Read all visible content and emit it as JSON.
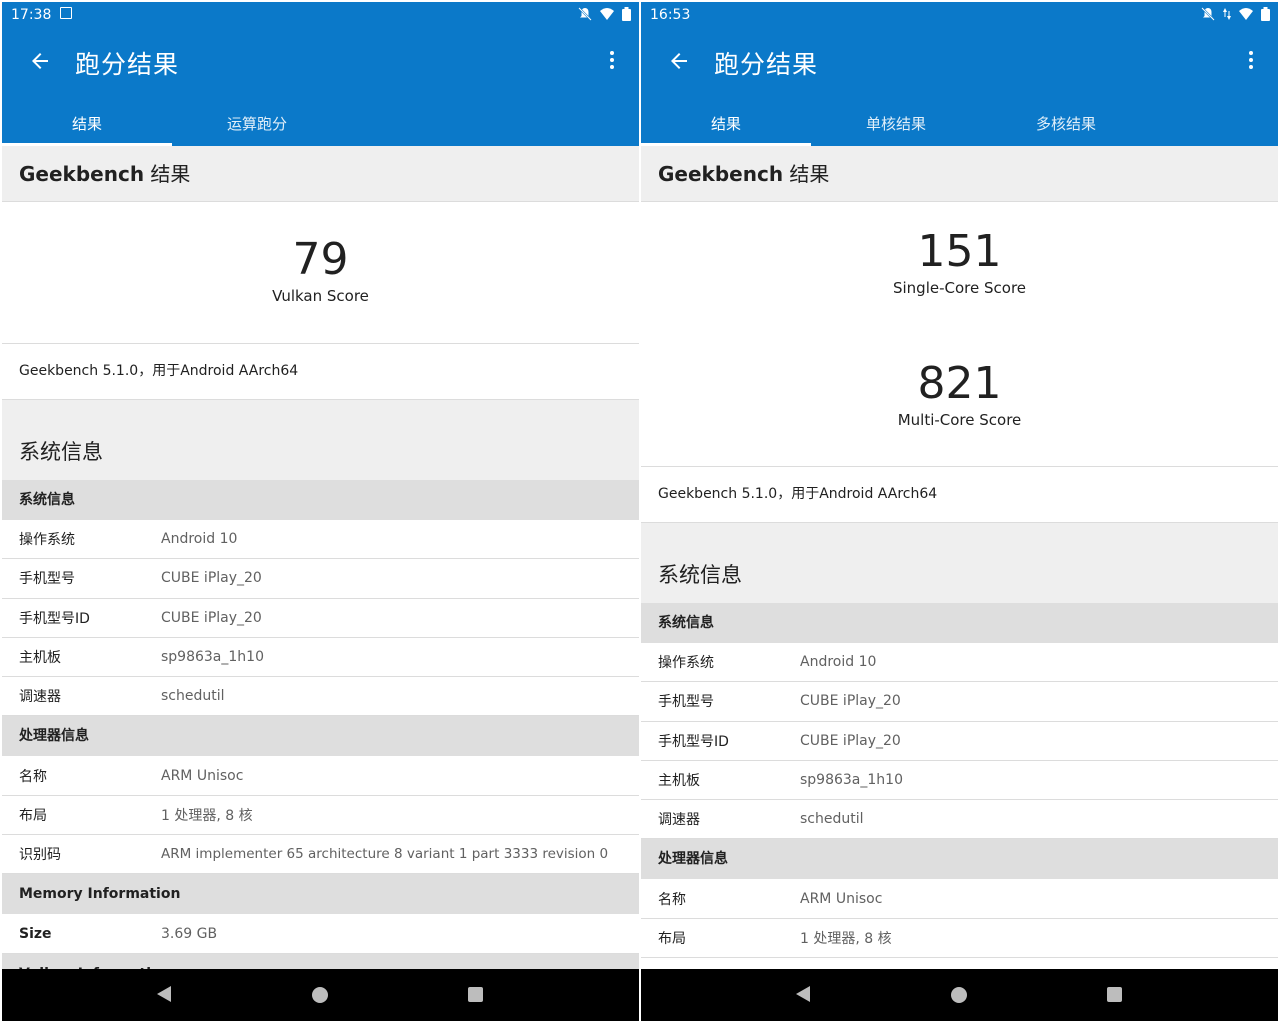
{
  "left": {
    "status": {
      "time": "17:38"
    },
    "appbar": {
      "title": "跑分结果"
    },
    "tabs": [
      "结果",
      "运算跑分"
    ],
    "header": {
      "latin": "Geekbench",
      "cn": " 结果"
    },
    "scores": [
      {
        "value": "79",
        "label": "Vulkan Score"
      }
    ],
    "version": "Geekbench 5.1.0，用于Android AArch64",
    "sysinfo_title": "系统信息",
    "sections": [
      {
        "title": "系统信息",
        "rows": [
          {
            "k": "操作系统",
            "v": "Android 10"
          },
          {
            "k": "手机型号",
            "v": "CUBE iPlay_20"
          },
          {
            "k": "手机型号ID",
            "v": "CUBE iPlay_20"
          },
          {
            "k": "主机板",
            "v": "sp9863a_1h10"
          },
          {
            "k": "调速器",
            "v": "schedutil"
          }
        ]
      },
      {
        "title": "处理器信息",
        "rows": [
          {
            "k": "名称",
            "v": "ARM Unisoc"
          },
          {
            "k": "布局",
            "v": "1 处理器, 8 核"
          },
          {
            "k": "识别码",
            "v": "ARM implementer 65 architecture 8 variant 1 part 3333 revision 0"
          }
        ]
      },
      {
        "title": "Memory Information",
        "rows": [
          {
            "k": "Size",
            "v": "3.69 GB"
          }
        ]
      },
      {
        "title": "Vulkan Information",
        "rows": []
      }
    ]
  },
  "right": {
    "status": {
      "time": "16:53"
    },
    "appbar": {
      "title": "跑分结果"
    },
    "tabs": [
      "结果",
      "单核结果",
      "多核结果"
    ],
    "header": {
      "latin": "Geekbench",
      "cn": " 结果"
    },
    "scores": [
      {
        "value": "151",
        "label": "Single-Core Score"
      },
      {
        "value": "821",
        "label": "Multi-Core Score"
      }
    ],
    "version": "Geekbench 5.1.0，用于Android AArch64",
    "sysinfo_title": "系统信息",
    "sections": [
      {
        "title": "系统信息",
        "rows": [
          {
            "k": "操作系统",
            "v": "Android 10"
          },
          {
            "k": "手机型号",
            "v": "CUBE iPlay_20"
          },
          {
            "k": "手机型号ID",
            "v": "CUBE iPlay_20"
          },
          {
            "k": "主机板",
            "v": "sp9863a_1h10"
          },
          {
            "k": "调速器",
            "v": "schedutil"
          }
        ]
      },
      {
        "title": "处理器信息",
        "rows": [
          {
            "k": "名称",
            "v": "ARM Unisoc"
          },
          {
            "k": "布局",
            "v": "1 处理器, 8 核"
          }
        ]
      }
    ]
  },
  "colors": {
    "appbar": "#0b79c9",
    "header_bg": "#efefef",
    "section_bg": "#dedede"
  }
}
